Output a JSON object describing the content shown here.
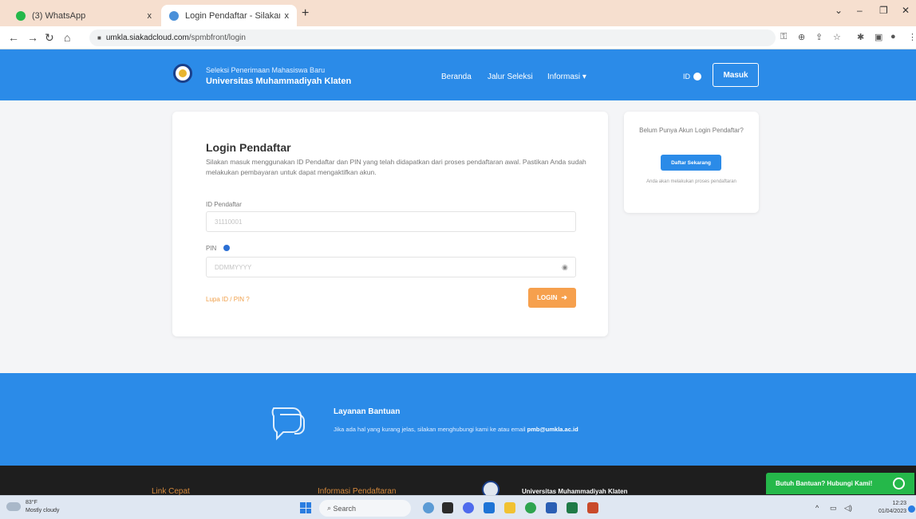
{
  "browser": {
    "tabs": [
      {
        "label": "(3) WhatsApp",
        "favicon_color": "#25b84a"
      },
      {
        "label": "Login Pendaftar - Silakan masuk",
        "favicon_color": "#4a90d9"
      }
    ],
    "close_glyph": "x",
    "new_tab_glyph": "+",
    "url_host": "umkla.siakadcloud.com",
    "url_path": "/spmbfront/login"
  },
  "header": {
    "subtitle": "Seleksi Penerimaan Mahasiswa Baru",
    "title": "Universitas Muhammadiyah Klaten",
    "nav": [
      "Beranda",
      "Jalur Seleksi",
      "Informasi"
    ],
    "dropdown_glyph": "▾",
    "lang": "ID",
    "login_button": "Masuk"
  },
  "login": {
    "title": "Login Pendaftar",
    "description": "Silakan masuk menggunakan ID Pendaftar dan PIN yang telah didapatkan dari proses pendaftaran awal. Pastikan Anda sudah melakukan pembayaran untuk dapat mengaktifkan akun.",
    "id_label": "ID Pendaftar",
    "id_placeholder": "31110001",
    "pin_label": "PIN",
    "pin_placeholder": "DDMMYYYY",
    "forgot": "Lupa ID / PIN ?",
    "button": "LOGIN"
  },
  "signup": {
    "question": "Belum Punya Akun Login Pendaftar?",
    "button": "Daftar Sekarang",
    "note": "Anda akan melakukan proses pendaftaran"
  },
  "help": {
    "title": "Layanan Bantuan",
    "text": "Jika ada hal yang kurang jelas, silakan menghubungi kami ke atau email",
    "email": "pmb@umkla.ac.id"
  },
  "footer": {
    "col1": "Link Cepat",
    "col2": "Informasi Pendaftaran",
    "university": "Universitas Muhammadiyah Klaten",
    "help_button": "Butuh Bantuan? Hubungi Kami!"
  },
  "taskbar": {
    "temperature": "83°F",
    "weather": "Mostly cloudy",
    "search": "Search",
    "time": "12:23",
    "date": "01/04/2023"
  }
}
